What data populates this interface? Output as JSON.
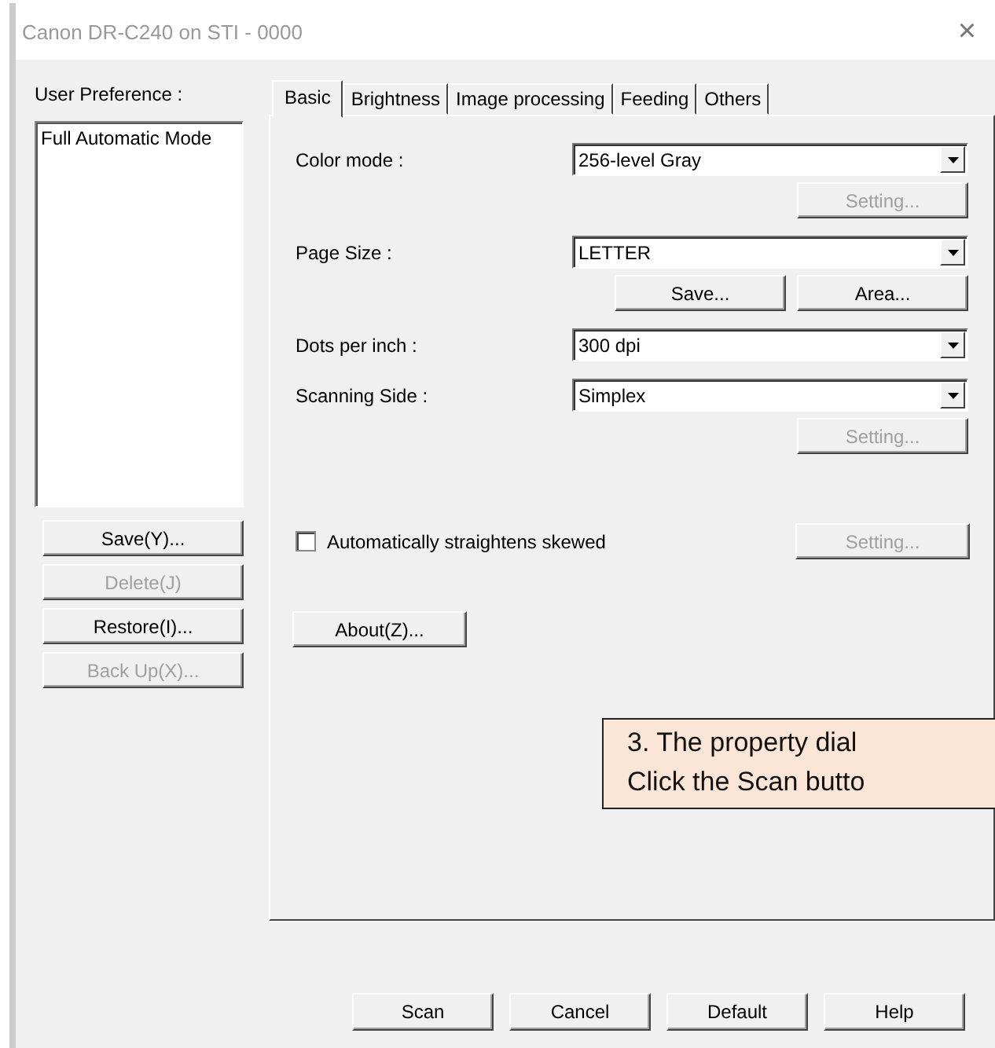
{
  "window": {
    "title": "Canon DR-C240 on STI - 0000",
    "close": "×"
  },
  "preferences": {
    "label": "User Preference :",
    "items": [
      {
        "text": "Full Automatic Mode",
        "selected": false
      }
    ],
    "buttons": [
      {
        "label": "Save(Y)...",
        "disabled": false
      },
      {
        "label": "Delete(J)",
        "disabled": true
      },
      {
        "label": "Restore(I)...",
        "disabled": false
      },
      {
        "label": "Back Up(X)...",
        "disabled": true
      }
    ]
  },
  "tabs": [
    {
      "label": "Basic",
      "selected": true
    },
    {
      "label": "Brightness",
      "selected": false
    },
    {
      "label": "Image processing",
      "selected": false
    },
    {
      "label": "Feeding",
      "selected": false
    },
    {
      "label": "Others",
      "selected": false
    }
  ],
  "basic": {
    "fields": [
      {
        "label": "Color mode :",
        "value": "256-level Gray",
        "buttons": [
          {
            "label": "Setting...",
            "disabled": true
          }
        ]
      },
      {
        "label": "Page Size :",
        "value": "LETTER",
        "buttons": [
          {
            "label": "Save...",
            "disabled": false
          },
          {
            "label": "Area...",
            "disabled": false
          }
        ]
      },
      {
        "label": "Dots per inch :",
        "value": "300 dpi"
      },
      {
        "label": "Scanning Side :",
        "value": "Simplex",
        "buttons": [
          {
            "label": "Setting...",
            "disabled": true
          }
        ]
      }
    ],
    "straighten": {
      "label": "Automatically straightens skewed",
      "checked": false,
      "button": {
        "label": "Setting...",
        "disabled": true
      }
    },
    "about": "About(Z)..."
  },
  "buttons": [
    "Scan",
    "Cancel",
    "Default",
    "Help"
  ],
  "callout": {
    "lines": [
      "3. The property dial",
      "Click the Scan butto"
    ]
  }
}
